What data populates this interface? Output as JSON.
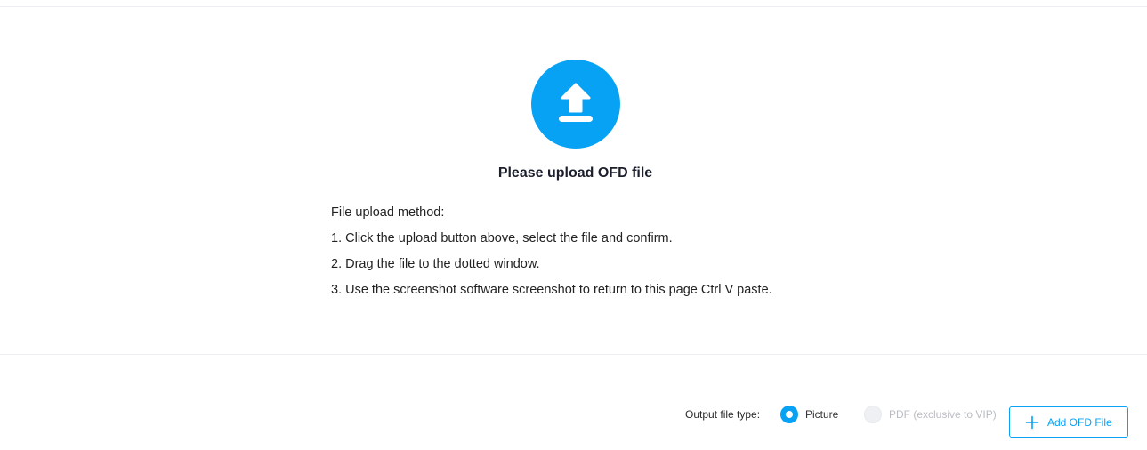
{
  "upload": {
    "icon": "upload-icon",
    "title": "Please upload OFD file",
    "instructions": {
      "heading": "File upload method:",
      "steps": [
        "1. Click the upload button above, select the file and confirm.",
        "2. Drag the file to the dotted window.",
        "3. Use the screenshot software screenshot to return to this page Ctrl V paste."
      ]
    }
  },
  "output": {
    "label": "Output file type:",
    "options": [
      {
        "label": "Picture",
        "selected": true,
        "enabled": true
      },
      {
        "label": "PDF (exclusive to VIP)",
        "selected": false,
        "enabled": false
      }
    ]
  },
  "actions": {
    "add_icon": "plus-icon",
    "add_label": "Add OFD File"
  },
  "colors": {
    "accent": "#08a2f5",
    "title": "#1b1e2b",
    "disabled_text": "#b9bcc2",
    "divider": "#eceef2"
  }
}
